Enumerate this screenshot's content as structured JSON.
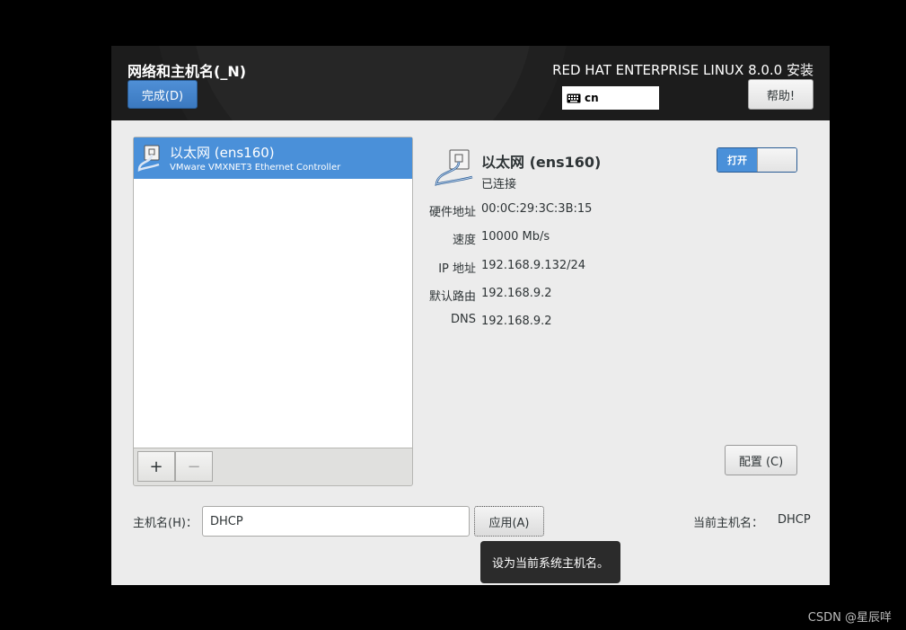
{
  "header": {
    "title": "网络和主机名(_N)",
    "done_label": "完成(D)",
    "product_title": "RED HAT ENTERPRISE LINUX 8.0.0 安装",
    "keyboard_layout": "cn",
    "help_label": "帮助!"
  },
  "connections": {
    "items": [
      {
        "name": "以太网 (ens160)",
        "description": "VMware VMXNET3 Ethernet Controller"
      }
    ],
    "add_label": "+",
    "remove_label": "−"
  },
  "detail": {
    "name": "以太网 (ens160)",
    "status": "已连接",
    "toggle_label": "打开",
    "properties": [
      {
        "label": "硬件地址",
        "value": "00:0C:29:3C:3B:15"
      },
      {
        "label": "速度",
        "value": "10000 Mb/s"
      },
      {
        "label": "IP 地址",
        "value": "192.168.9.132/24"
      },
      {
        "label": "默认路由",
        "value": "192.168.9.2"
      },
      {
        "label": "DNS",
        "value": "192.168.9.2"
      }
    ],
    "configure_label": "配置 (C)"
  },
  "hostname": {
    "label": "主机名(H)：",
    "value": "DHCP",
    "apply_label": "应用(A)",
    "current_label": "当前主机名：",
    "current_value": "DHCP"
  },
  "tooltip": "设为当前系统主机名。",
  "watermark": "CSDN @星辰咩",
  "colors": {
    "accent": "#4a90d9",
    "header_bg": "#1c1c1c",
    "window_bg": "#ececec"
  }
}
